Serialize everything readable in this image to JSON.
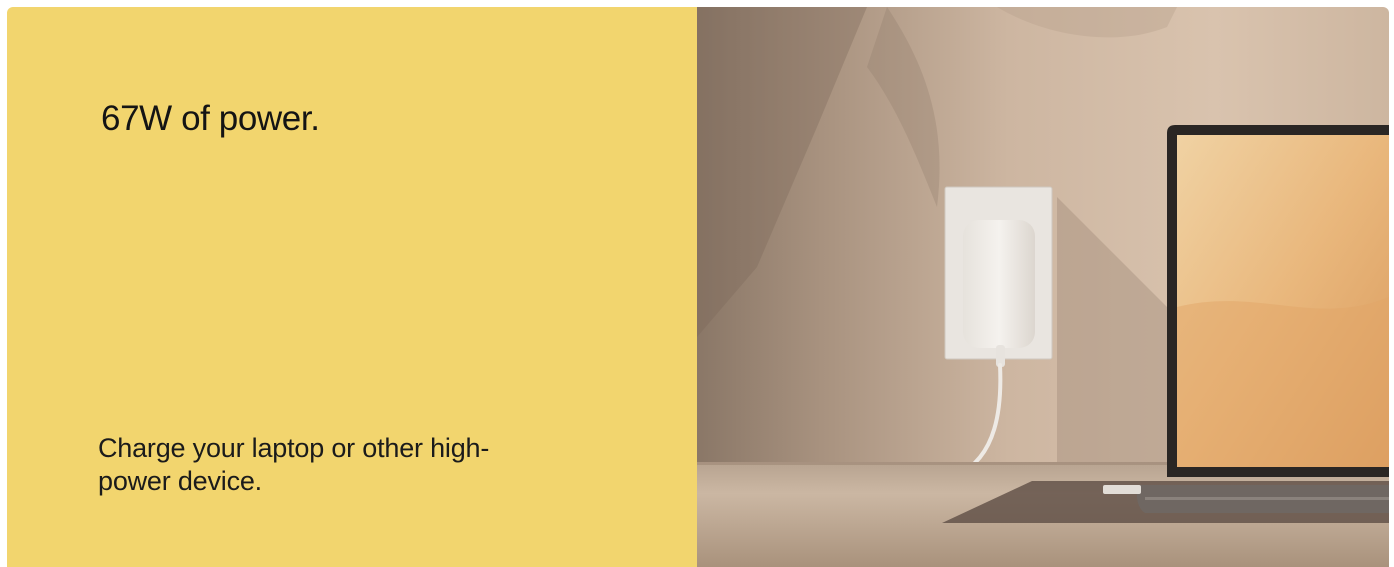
{
  "feature": {
    "headline": "67W of power.",
    "description": "Charge your laptop or other high-power device."
  },
  "colors": {
    "panel_background": "#f2d56e",
    "text": "#141414",
    "wall": "#d3bca6",
    "desk": "#c8b39e"
  },
  "image": {
    "subject": "wall-charger-plugged-in-charging-laptop-on-desk"
  }
}
